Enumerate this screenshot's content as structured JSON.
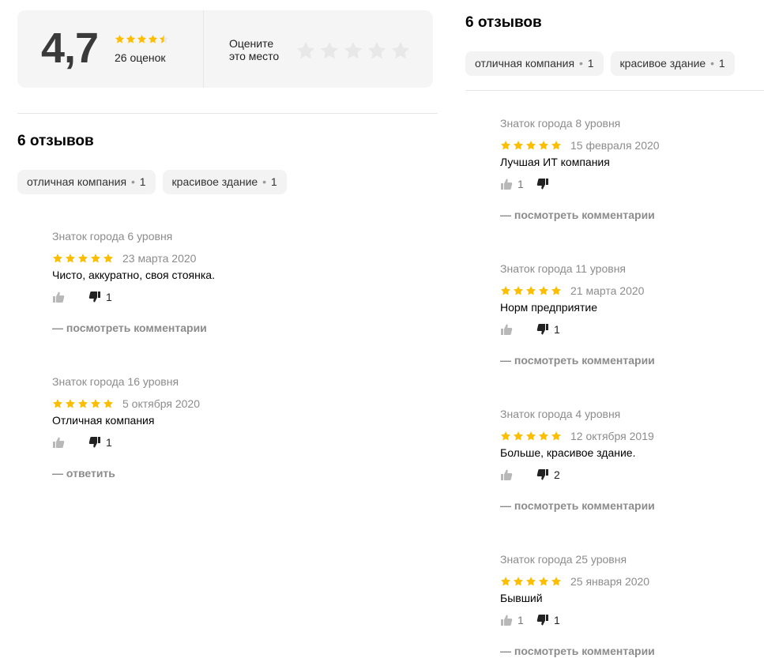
{
  "rating_card": {
    "value": "4,7",
    "stars_filled": 4.5,
    "count_text": "26 оценок",
    "rate_label_line1": "Оцените",
    "rate_label_line2": "это место",
    "rate_stars_total": 5
  },
  "colors": {
    "star_gold": "#fdbd00",
    "star_empty": "#e8e8e8",
    "muted_text": "#8c8c8c"
  },
  "left": {
    "title": "6 отзывов",
    "tags": [
      {
        "label": "отличная компания",
        "count": "1"
      },
      {
        "label": "красивое здание",
        "count": "1"
      }
    ],
    "reviews": [
      {
        "author": "Знаток города 6 уровня",
        "stars": 5,
        "date": "23 марта 2020",
        "text": "Чисто, аккуратно, своя стоянка.",
        "likes": "",
        "dislikes": "1",
        "action": "— посмотреть комментарии"
      },
      {
        "author": "Знаток города 16 уровня",
        "stars": 5,
        "date": "5 октября 2020",
        "text": "Отличная компания",
        "likes": "",
        "dislikes": "1",
        "action": "— ответить"
      }
    ]
  },
  "right": {
    "title": "6 отзывов",
    "tags": [
      {
        "label": "отличная компания",
        "count": "1"
      },
      {
        "label": "красивое здание",
        "count": "1"
      }
    ],
    "reviews": [
      {
        "author": "Знаток города 8 уровня",
        "stars": 5,
        "date": "15 февраля 2020",
        "text": "Лучшая ИТ компания",
        "likes": "1",
        "dislikes": "",
        "action": "— посмотреть комментарии"
      },
      {
        "author": "Знаток города 11 уровня",
        "stars": 5,
        "date": "21 марта 2020",
        "text": "Норм предприятие",
        "likes": "",
        "dislikes": "1",
        "action": "— посмотреть комментарии"
      },
      {
        "author": "Знаток города 4 уровня",
        "stars": 5,
        "date": "12 октября 2019",
        "text": "Больше, красивое здание.",
        "likes": "",
        "dislikes": "2",
        "action": "— посмотреть комментарии"
      },
      {
        "author": "Знаток города 25 уровня",
        "stars": 5,
        "date": "25 января 2020",
        "text": "Бывший",
        "likes": "1",
        "dislikes": "1",
        "action": "— посмотреть комментарии"
      }
    ]
  }
}
